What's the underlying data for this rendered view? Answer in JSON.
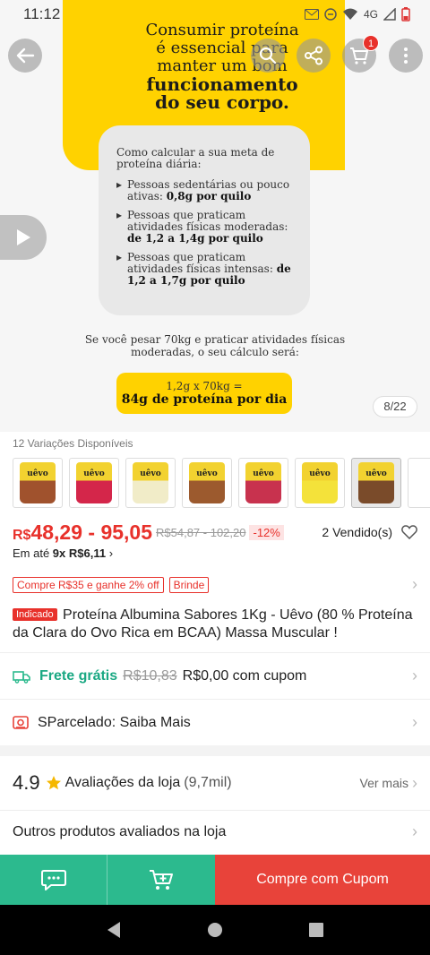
{
  "status_bar": {
    "time": "11:12",
    "network": "4G"
  },
  "hero": {
    "headline_lines": [
      "Consumir proteína",
      "é essencial para",
      "manter um bom",
      "funcionamento",
      "do seu corpo."
    ],
    "card_title": "Como calcular a sua meta de proteína diária:",
    "items": [
      {
        "text": "Pessoas sedentárias ou pouco ativas: ",
        "bold": "0,8g por quilo"
      },
      {
        "text": "Pessoas que praticam atividades físicas moderadas: ",
        "bold": "de 1,2 a 1,4g por quilo"
      },
      {
        "text": "Pessoas que praticam atividades físicas intensas: ",
        "bold": "de 1,2 a 1,7g por quilo"
      }
    ],
    "calc_text": "Se você pesar 70kg e praticar atividades físicas moderadas, o seu cálculo será:",
    "calc_line1": "1,2g x 70kg =",
    "calc_line2": "84g de proteína por dia",
    "page_indicator": "8/22"
  },
  "top_bar": {
    "cart_count": "1"
  },
  "variations": {
    "label": "12 Variações Disponíveis",
    "brand": "uêvo",
    "colors": [
      "#a0522d",
      "#d4264a",
      "#f1ecc8",
      "#9c5a2e",
      "#c8324e",
      "#f4e23a",
      "#7a4b2a"
    ]
  },
  "price": {
    "currency": "R$",
    "range": "48,29 - 95,05",
    "old": "R$54,87 - 102,20",
    "discount": "-12%",
    "sold": "2 Vendido(s)",
    "installment_prefix": "Em até ",
    "installment_bold": "9x R$6,11",
    "installment_chevron": "›"
  },
  "tags": [
    "Compre R$35 e ganhe 2% off",
    "Brinde"
  ],
  "product": {
    "badge": "Indicado",
    "title": "Proteína Albumina Sabores 1Kg - Uêvo (80 % Proteína da Clara do Ovo Rica em BCAA) Massa Muscular !"
  },
  "shipping": {
    "label": "Frete grátis",
    "old": "R$10,83",
    "new": "R$0,00 com cupom"
  },
  "parcel": {
    "label": "SParcelado: Saiba Mais"
  },
  "rating": {
    "score": "4.9",
    "label": "Avaliações da loja",
    "count": "(9,7mil)",
    "more": "Ver mais"
  },
  "others": {
    "label": "Outros produtos avaliados na loja"
  },
  "action_bar": {
    "buy_label": "Compre com Cupom"
  },
  "colors": {
    "accent_red": "#e8312b",
    "green": "#2cba8e",
    "yellow": "#ffd200"
  }
}
